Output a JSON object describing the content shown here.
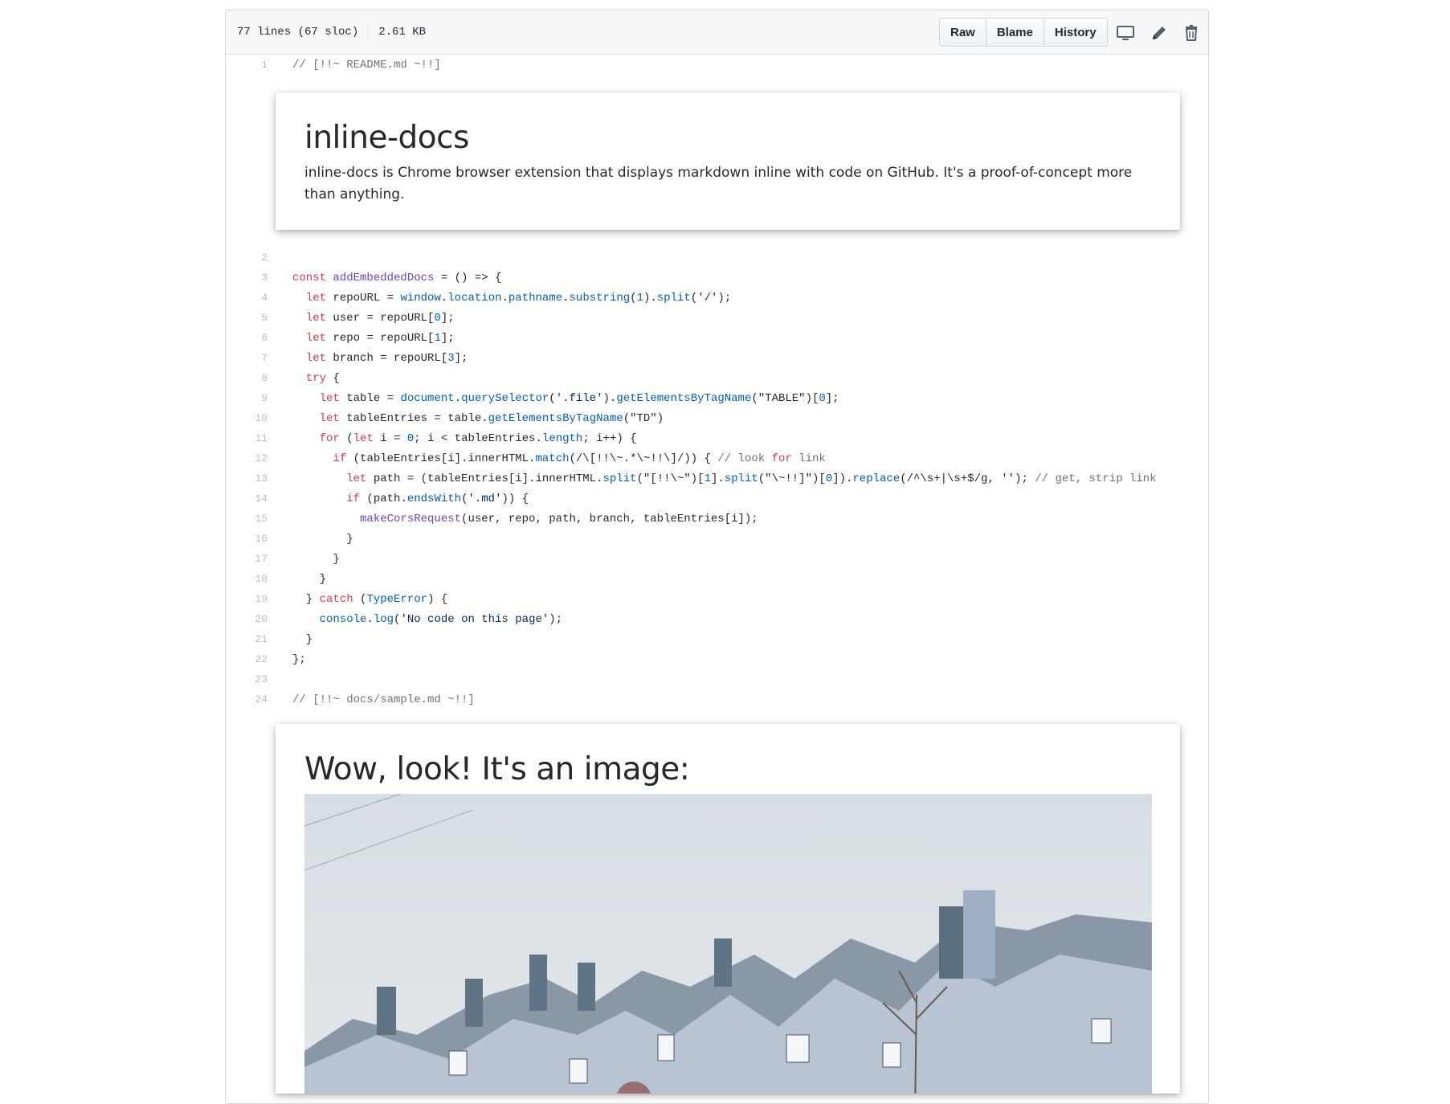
{
  "file_header": {
    "lines_info": "77 lines (67 sloc)",
    "size": "2.61 KB",
    "buttons": {
      "raw": "Raw",
      "blame": "Blame",
      "history": "History"
    },
    "icons": [
      "desktop-icon",
      "pencil-icon",
      "trash-icon"
    ]
  },
  "readme_card": {
    "title": "inline-docs",
    "body": "inline-docs is Chrome browser extension that displays markdown inline with code on GitHub. It's a proof-of-concept more than anything."
  },
  "sample_card": {
    "title": "Wow, look! It's an image:"
  },
  "code_lines": [
    {
      "n": "1",
      "text": "// [!!~ README.md ~!!]"
    },
    {
      "n": "2",
      "text": ""
    },
    {
      "n": "3",
      "text": "const addEmbeddedDocs = () => {"
    },
    {
      "n": "4",
      "text": "  let repoURL = window.location.pathname.substring(1).split('/');"
    },
    {
      "n": "5",
      "text": "  let user = repoURL[0];"
    },
    {
      "n": "6",
      "text": "  let repo = repoURL[1];"
    },
    {
      "n": "7",
      "text": "  let branch = repoURL[3];"
    },
    {
      "n": "8",
      "text": "  try {"
    },
    {
      "n": "9",
      "text": "    let table = document.querySelector('.file').getElementsByTagName(\"TABLE\")[0];"
    },
    {
      "n": "10",
      "text": "    let tableEntries = table.getElementsByTagName(\"TD\")"
    },
    {
      "n": "11",
      "text": "    for (let i = 0; i < tableEntries.length; i++) {"
    },
    {
      "n": "12",
      "text": "      if (tableEntries[i].innerHTML.match(/\\[!!\\~.*\\~!!\\]/)) { // look for link"
    },
    {
      "n": "13",
      "text": "        let path = (tableEntries[i].innerHTML.split(\"[!!\\~\")[1].split(\"\\~!!]\")[0]).replace(/^\\s+|\\s+$/g, ''); // get, strip link"
    },
    {
      "n": "14",
      "text": "        if (path.endsWith('.md')) {"
    },
    {
      "n": "15",
      "text": "          makeCorsRequest(user, repo, path, branch, tableEntries[i]);"
    },
    {
      "n": "16",
      "text": "        }"
    },
    {
      "n": "17",
      "text": "      }"
    },
    {
      "n": "18",
      "text": "    }"
    },
    {
      "n": "19",
      "text": "  } catch (TypeError) {"
    },
    {
      "n": "20",
      "text": "    console.log('No code on this page');"
    },
    {
      "n": "21",
      "text": "  }"
    },
    {
      "n": "22",
      "text": "};"
    },
    {
      "n": "23",
      "text": ""
    },
    {
      "n": "24",
      "text": "// [!!~ docs/sample.md ~!!]"
    }
  ]
}
